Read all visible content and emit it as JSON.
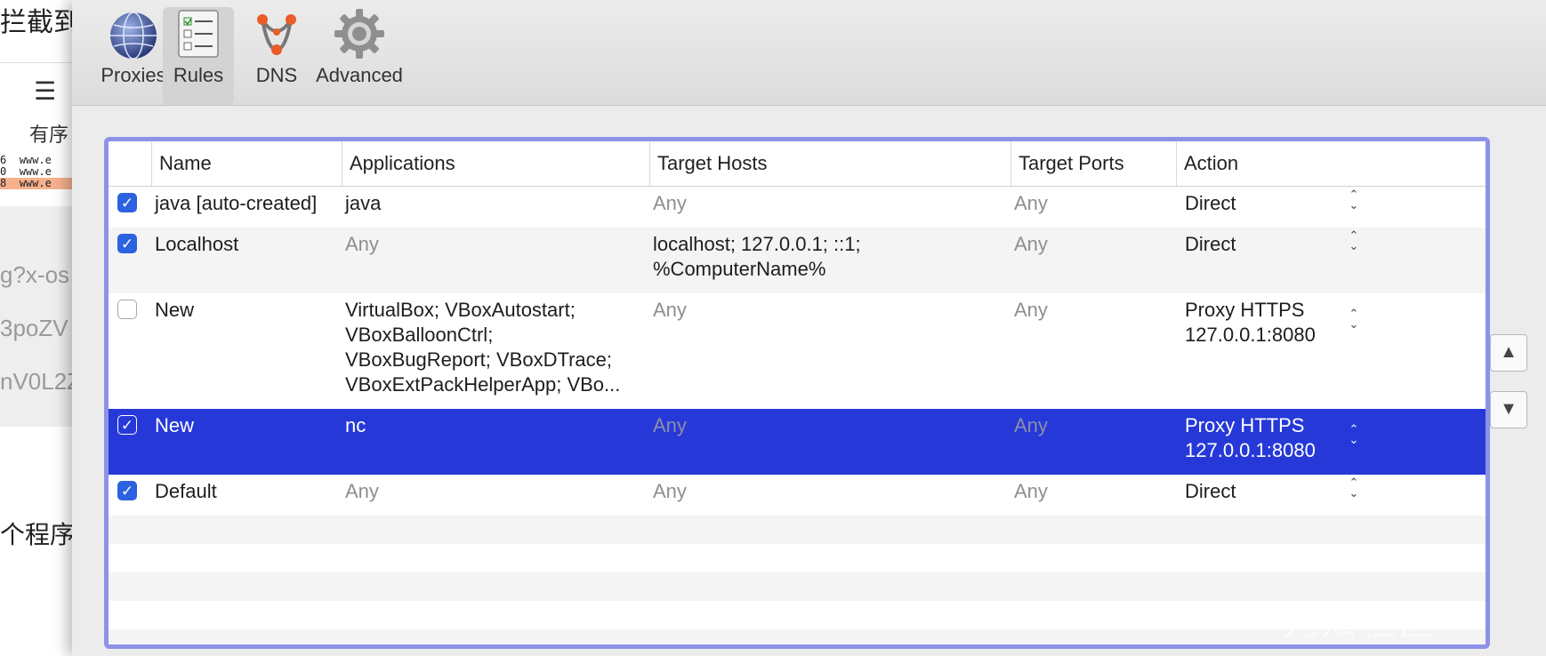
{
  "background_window": {
    "title": "拦截到",
    "order_label": "有序",
    "url_rows": [
      {
        "num": "6",
        "url": "www.e"
      },
      {
        "num": "0",
        "url": "www.e"
      },
      {
        "num": "8",
        "url": "www.e"
      }
    ],
    "code_lines": [
      "g?x-os",
      "3poZV",
      "nV0L2Z"
    ],
    "program_text": "个程序"
  },
  "toolbar": {
    "tabs": [
      {
        "label": "Proxies",
        "icon": "globe-icon",
        "selected": false
      },
      {
        "label": "Rules",
        "icon": "rules-list-icon",
        "selected": true
      },
      {
        "label": "DNS",
        "icon": "dns-network-icon",
        "selected": false
      },
      {
        "label": "Advanced",
        "icon": "gear-icon",
        "selected": false
      }
    ]
  },
  "table": {
    "columns": [
      "Name",
      "Applications",
      "Target Hosts",
      "Target Ports",
      "Action"
    ],
    "rows": [
      {
        "enabled": true,
        "name": "java [auto-created]",
        "applications": "java",
        "apps_muted": false,
        "hosts": "Any",
        "hosts_muted": true,
        "ports": "Any",
        "action": [
          "Direct"
        ]
      },
      {
        "enabled": true,
        "name": "Localhost",
        "applications": "Any",
        "apps_muted": true,
        "hosts": "localhost; 127.0.0.1; ::1;\n%ComputerName%",
        "hosts_muted": false,
        "ports": "Any",
        "action": [
          "Direct"
        ]
      },
      {
        "enabled": false,
        "name": "New",
        "applications": "VirtualBox; VBoxAutostart;\nVBoxBalloonCtrl;\nVBoxBugReport; VBoxDTrace;\nVBoxExtPackHelperApp; VBo...",
        "apps_muted": false,
        "hosts": "Any",
        "hosts_muted": true,
        "ports": "Any",
        "action": [
          "Proxy HTTPS",
          "127.0.0.1:8080"
        ]
      },
      {
        "enabled": true,
        "name": "New",
        "applications": "nc",
        "apps_muted": false,
        "hosts": "Any",
        "hosts_muted": true,
        "ports": "Any",
        "action": [
          "Proxy HTTPS",
          "127.0.0.1:8080"
        ],
        "selected": true
      },
      {
        "enabled": true,
        "name": "Default",
        "applications": "Any",
        "apps_muted": true,
        "hosts": "Any",
        "hosts_muted": true,
        "ports": "Any",
        "action": [
          "Direct"
        ]
      }
    ]
  },
  "move_buttons": {
    "up": "▲",
    "down": "▼"
  },
  "watermark": "先知社区",
  "colors": {
    "selection": "#2639d8",
    "focus_ring": "#8d92e8",
    "checkbox": "#2a62e0"
  }
}
